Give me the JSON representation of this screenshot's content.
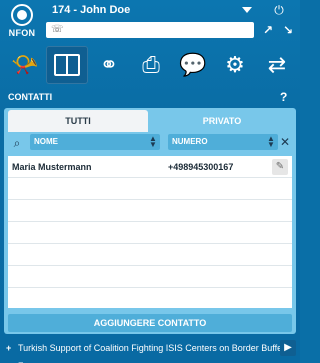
{
  "app": {
    "logo_text": "NFON",
    "user_label": "174 - John Doe",
    "dial_placeholder": ""
  },
  "section": {
    "title": "CONTATTI",
    "help": "?"
  },
  "tabs": [
    {
      "label": "TUTTI",
      "active": false
    },
    {
      "label": "PRIVATO",
      "active": true
    }
  ],
  "columns": {
    "name": "NOME",
    "number": "NUMERO"
  },
  "contacts": [
    {
      "name": "Maria Mustermann",
      "number": "+498945300167"
    }
  ],
  "add_button": "AGGIUNGERE CONTATTO",
  "ticker": {
    "plus": "+",
    "text": "Turkish Support of Coalition Fighting ISIS Centers on Border Buffer Zone"
  },
  "colors": {
    "background": "#0a6fa7",
    "panel": "#78c7ea",
    "accent": "#4faed9"
  },
  "icons": {
    "toolbar": [
      "horn-icon",
      "book-icon",
      "org-chart-icon",
      "printer-icon",
      "chat-icon",
      "gear-icon",
      "swap-icon"
    ]
  }
}
